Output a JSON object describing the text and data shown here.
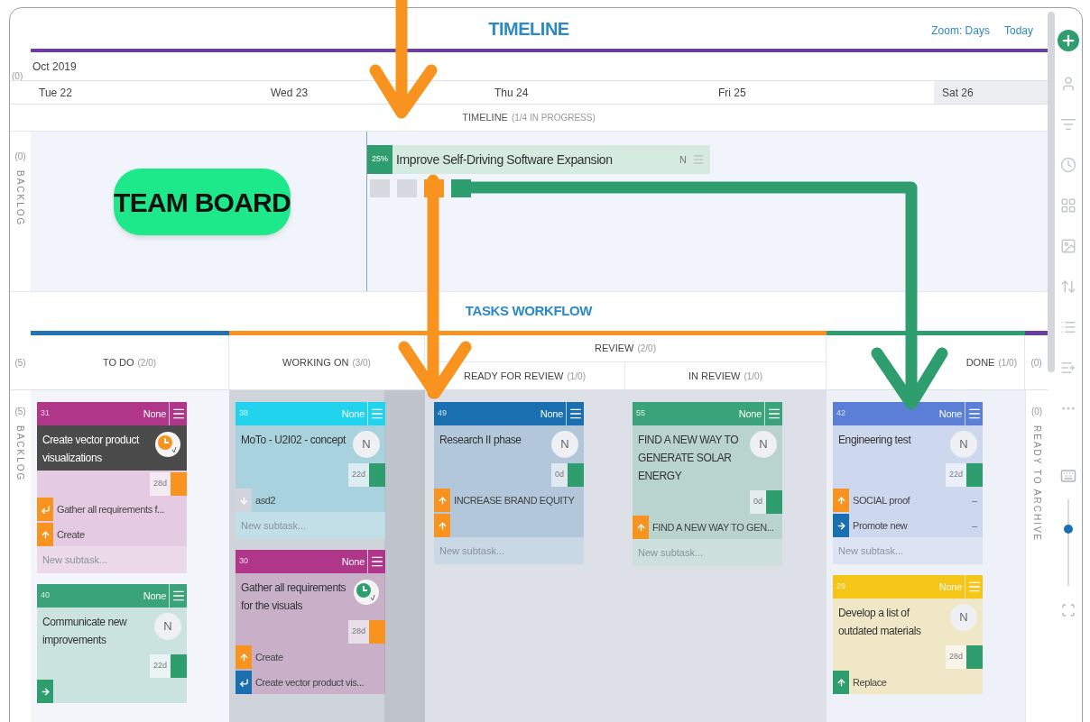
{
  "header": {
    "title": "TIMELINE",
    "links": [
      "Zoom: Days",
      "Today"
    ]
  },
  "timeline": {
    "count": "(0)",
    "month": "Oct 2019",
    "days": [
      {
        "label": "Tue 22",
        "weekend": false
      },
      {
        "label": "Wed 23",
        "weekend": false
      },
      {
        "label": "Thu 24",
        "weekend": false
      },
      {
        "label": "Fri 25",
        "weekend": false
      },
      {
        "label": "Sat 26",
        "weekend": true
      }
    ],
    "lane_title": "TIMELINE",
    "lane_status": "(1/4 IN PROGRESS)",
    "backlog": {
      "count": "(0)",
      "label": "BACKLOG"
    },
    "task": {
      "percent": "25%",
      "title": "Improve Self-Driving Software Expansion",
      "assignee": "N",
      "markers": [
        {
          "color": "#d5d9de"
        },
        {
          "color": "#d5d9de"
        },
        {
          "color": "#f7931e"
        },
        {
          "color": "#2e9e6e"
        }
      ]
    }
  },
  "badge": "TEAM BOARD",
  "workflow": {
    "title": "TASKS WORKFLOW",
    "count": "(5)",
    "backlog": {
      "count": "(5)",
      "label": "BACKLOG"
    },
    "archive": {
      "header_count": "(0)",
      "count": "(0)",
      "label": "READY TO ARCHIVE"
    },
    "columns": [
      {
        "title": "TO DO",
        "count": "(2/0)",
        "color": "#2272b4",
        "cards": [
          {
            "id": "31",
            "color": "#b0368a",
            "priority": "None",
            "title": "Create vector product visualizations",
            "highlighted": true,
            "avatar": {
              "kind": "clock",
              "color": "#f7931e"
            },
            "age": {
              "text": "28d",
              "color": "#f7931e"
            },
            "subtasks": [
              {
                "kind": "turn",
                "color": "#f7931e",
                "text": "Gather all requirements f..."
              },
              {
                "kind": "up",
                "color": "#f7931e",
                "text": "Create"
              }
            ],
            "placeholder": "New subtask..."
          },
          {
            "id": "40",
            "color": "#3aa37a",
            "priority": "None",
            "title": "Communicate new improvements",
            "highlighted": false,
            "avatar": {
              "kind": "initial",
              "text": "N"
            },
            "age": {
              "text": "22d",
              "color": "#2e9e6e"
            },
            "subtasks": [
              {
                "kind": "right",
                "color": "#2e9e6e"
              }
            ]
          }
        ]
      },
      {
        "title": "WORKING ON",
        "count": "(3/0)",
        "color": "#f7931e",
        "cards": [
          {
            "id": "38",
            "color": "#22d3ee",
            "priority": "None",
            "title": "MoTo - U2I02 - concept",
            "highlighted": false,
            "avatar": {
              "kind": "initial",
              "text": "N"
            },
            "age": {
              "text": "22d",
              "color": "#2e9e6e"
            },
            "subtasks": [
              {
                "kind": "down",
                "color": "#d1d5db",
                "text": "asd2"
              }
            ],
            "placeholder": "New subtask..."
          },
          {
            "id": "30",
            "color": "#b0368a",
            "priority": "None",
            "title": "Gather all requirements for the visuals",
            "highlighted": false,
            "avatar": {
              "kind": "clock",
              "color": "#2e9e6e"
            },
            "age": {
              "text": "28d",
              "color": "#f7931e"
            },
            "subtasks": [
              {
                "kind": "up",
                "color": "#f7931e",
                "text": "Create"
              },
              {
                "kind": "turn",
                "color": "#1a6fb0",
                "text": "Create vector product vis..."
              }
            ]
          }
        ]
      },
      {
        "title": "REVIEW",
        "count": "(2/0)",
        "color": "#f7931e",
        "sub": [
          {
            "title": "READY FOR REVIEW",
            "count": "(1/0)",
            "cards": [
              {
                "id": "49",
                "color": "#1a6fb0",
                "priority": "None",
                "title": "Research II phase",
                "highlighted": false,
                "avatar": {
                  "kind": "initial",
                  "text": "N"
                },
                "age": {
                  "text": "0d",
                  "color": "#2e9e6e"
                },
                "subtasks": [
                  {
                    "kind": "up",
                    "color": "#f7931e",
                    "text": "INCREASE BRAND EQUITY"
                  },
                  {
                    "kind": "up",
                    "color": "#f7931e"
                  }
                ],
                "placeholder": "New subtask..."
              }
            ]
          },
          {
            "title": "IN REVIEW",
            "count": "(1/0)",
            "cards": [
              {
                "id": "55",
                "color": "#3aa37a",
                "priority": "None",
                "title": "FIND A NEW WAY TO GENERATE SOLAR ENERGY",
                "highlighted": false,
                "avatar": {
                  "kind": "initial",
                  "text": "N"
                },
                "age": {
                  "text": "0d",
                  "color": "#2e9e6e"
                },
                "subtasks": [
                  {
                    "kind": "up",
                    "color": "#f7931e",
                    "text": "FIND A NEW WAY TO GEN..."
                  }
                ],
                "placeholder": "New subtask..."
              }
            ]
          }
        ]
      },
      {
        "title": "DONE",
        "count": "(1/0)",
        "color": "#2e9e6e",
        "cards": [
          {
            "id": "42",
            "color": "#5b7fd6",
            "priority": "None",
            "title": "Engineering test",
            "highlighted": false,
            "avatar": {
              "kind": "initial",
              "text": "N"
            },
            "age": {
              "text": "22d",
              "color": "#2e9e6e"
            },
            "subtasks": [
              {
                "kind": "up",
                "color": "#f7931e",
                "text": "SOCIAL proof",
                "menu": "–"
              },
              {
                "kind": "right",
                "color": "#1a6fb0",
                "text": "Promote new",
                "menu": "–"
              }
            ],
            "placeholder": "New subtask..."
          },
          {
            "id": "29",
            "color": "#f5c518",
            "priority": "None",
            "title": "Develop a list of outdated materials",
            "highlighted": false,
            "avatar": {
              "kind": "initial",
              "text": "N"
            },
            "age": {
              "text": "28d",
              "color": "#2e9e6e"
            },
            "subtasks": [
              {
                "kind": "up",
                "color": "#2e9e6e",
                "text": "Replace"
              }
            ]
          }
        ]
      }
    ]
  },
  "toolbar": {
    "zoom_slider": {
      "level": 0.67
    }
  }
}
